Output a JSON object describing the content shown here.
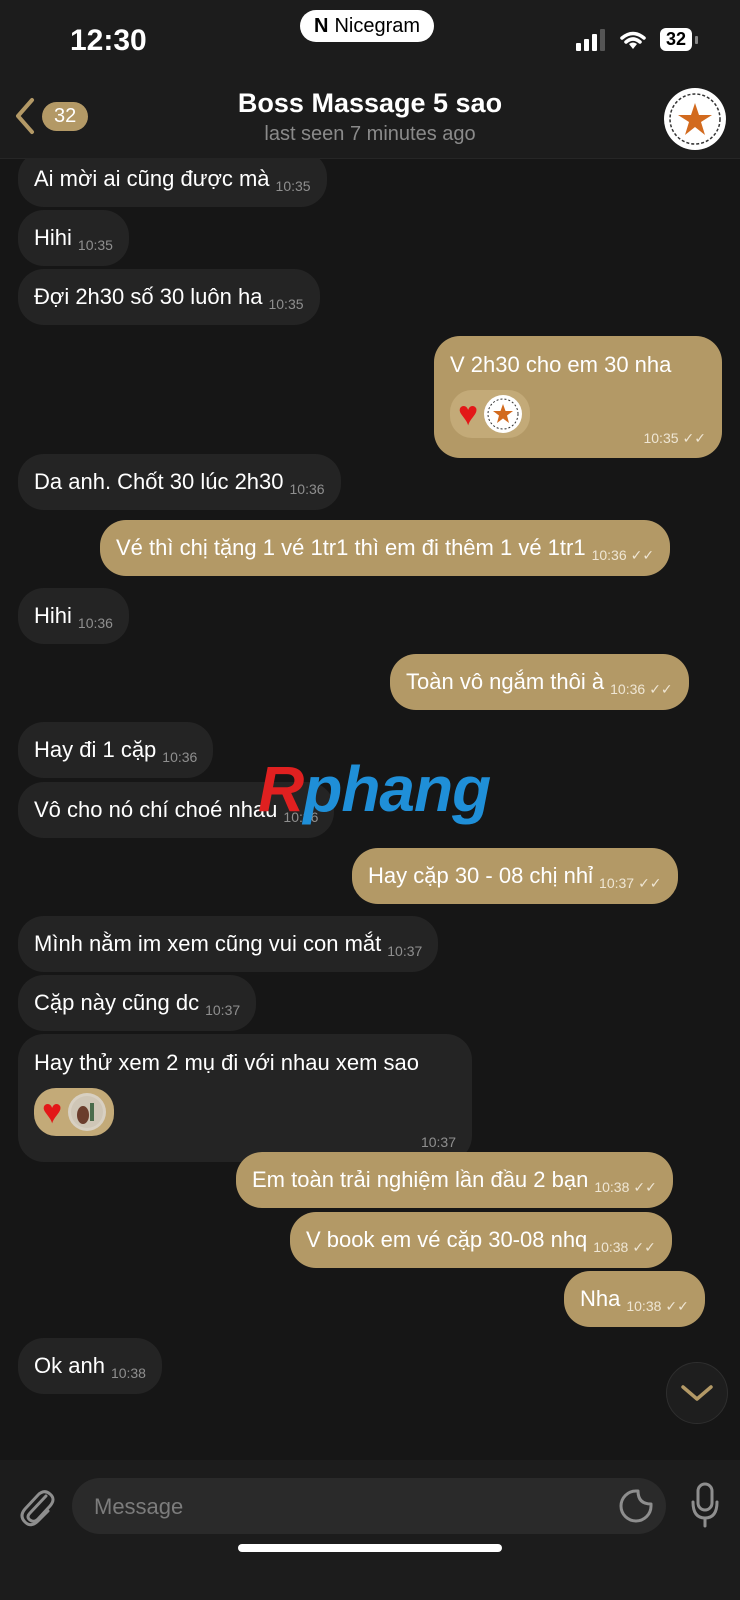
{
  "status": {
    "time": "12:30",
    "app_pill": "Nicegram",
    "battery": "32"
  },
  "header": {
    "back_count": "32",
    "title": "Boss Massage 5 sao",
    "subtitle": "last seen 7 minutes ago"
  },
  "messages": [
    {
      "text": "Ai mời ai cũng được mà",
      "time": "10:35"
    },
    {
      "text": "Hihi",
      "time": "10:35"
    },
    {
      "text": "Đợi 2h30 số 30 luôn ha",
      "time": "10:35"
    },
    {
      "text": "V 2h30 cho em 30 nha",
      "time": "10:35"
    },
    {
      "text": "Da anh. Chốt 30 lúc 2h30",
      "time": "10:36"
    },
    {
      "text": "Vé thì chị tặng 1 vé 1tr1 thì em đi thêm 1 vé 1tr1",
      "time": "10:36"
    },
    {
      "text": "Hihi",
      "time": "10:36"
    },
    {
      "text": "Toàn vô ngắm thôi à",
      "time": "10:36"
    },
    {
      "text": "Hay đi 1 cặp",
      "time": "10:36"
    },
    {
      "text": "Vô cho nó chí choé nhau",
      "time": "10:36"
    },
    {
      "text": "Hay cặp 30 - 08 chị nhỉ",
      "time": "10:37"
    },
    {
      "text": "Mình nằm im xem cũng vui con mắt",
      "time": "10:37"
    },
    {
      "text": "Cặp này cũng dc",
      "time": "10:37"
    },
    {
      "text": "Hay thử xem 2 mụ đi với nhau xem sao",
      "time": "10:37"
    },
    {
      "text": "Em toàn trải nghiệm lần đầu 2 bạn",
      "time": "10:38"
    },
    {
      "text": "V book em vé cặp 30-08 nhq",
      "time": "10:38"
    },
    {
      "text": "Nha",
      "time": "10:38"
    },
    {
      "text": "Ok anh",
      "time": "10:38"
    }
  ],
  "watermark": {
    "part1": "R",
    "part2": "phang"
  },
  "composer": {
    "placeholder": "Message"
  },
  "colors": {
    "outgoing": "#b39966",
    "incoming": "#242424",
    "background": "#161616"
  }
}
